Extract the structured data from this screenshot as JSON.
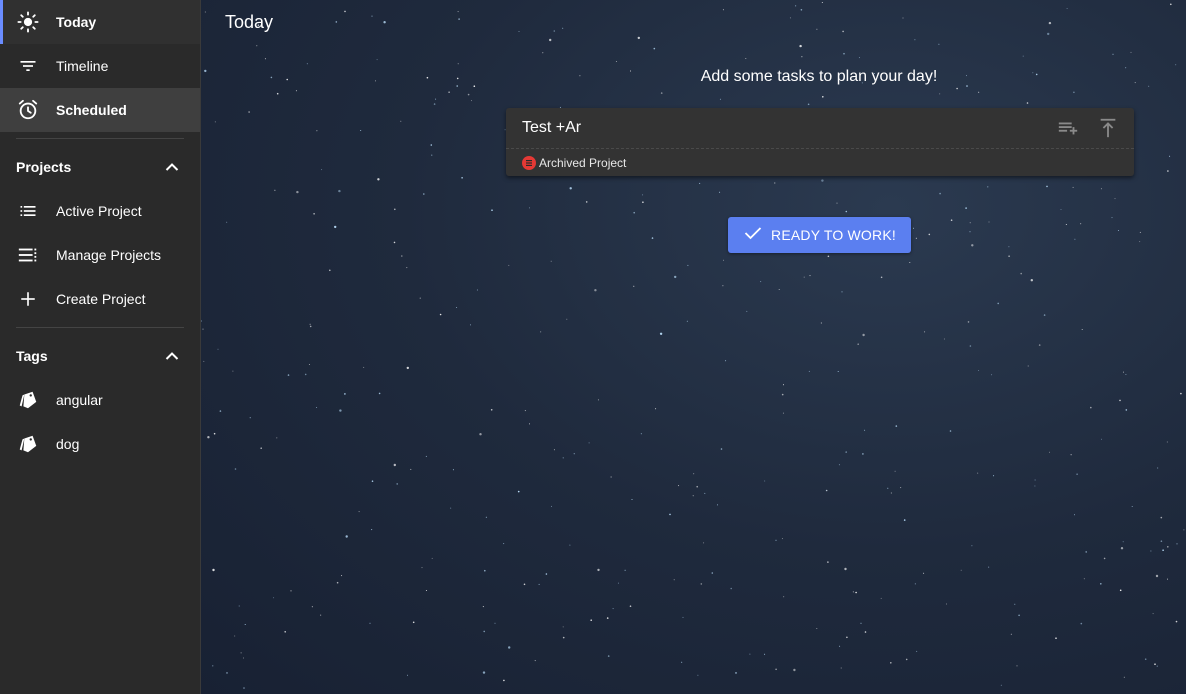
{
  "sidebar": {
    "nav": [
      {
        "label": "Today",
        "icon": "sun-icon"
      },
      {
        "label": "Timeline",
        "icon": "filter-list-icon"
      },
      {
        "label": "Scheduled",
        "icon": "alarm-icon"
      }
    ],
    "projects": {
      "title": "Projects",
      "items": [
        {
          "label": "Active Project",
          "icon": "list-icon"
        },
        {
          "label": "Manage Projects",
          "icon": "manage-list-icon"
        },
        {
          "label": "Create Project",
          "icon": "plus-icon"
        }
      ]
    },
    "tags": {
      "title": "Tags",
      "items": [
        {
          "label": "angular",
          "icon": "tag-icon"
        },
        {
          "label": "dog",
          "icon": "tag-icon"
        }
      ]
    }
  },
  "main": {
    "title": "Today",
    "hint": "Add some tasks to plan your day!",
    "task": {
      "title": "Test +Ar",
      "project_tag": "Archived Project",
      "project_color": "#e53935"
    },
    "ready_button": "READY TO WORK!"
  },
  "colors": {
    "accent": "#5b7ff0",
    "sidebar_bg": "#2a2a2a",
    "card_bg": "#333333"
  }
}
